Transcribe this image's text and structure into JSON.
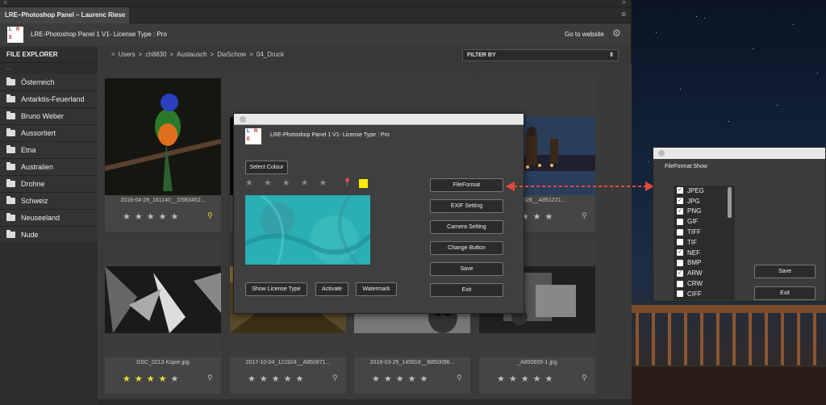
{
  "window": {
    "title": "LRE–Photoshop Panel – Laurenc Riese"
  },
  "header": {
    "app_name": "LRE-Photoshop Panel 1 V1- License Type : Pro",
    "go_to_website": "Go to website",
    "logo_letters": [
      "L",
      "R",
      "E"
    ]
  },
  "explorer": {
    "title": "FILE EXPLORER",
    "parent": "..",
    "folders": [
      "Österreich",
      "Antarktis-Feuerland",
      "Bruno Weber",
      "Aussortiert",
      "Etna",
      "Australien",
      "Drohne",
      "Schweiz",
      "Neuseeland",
      "Nude"
    ]
  },
  "breadcrumb": [
    ">",
    "Users",
    ">",
    "ch8830",
    ">",
    "Austausch",
    ">",
    "DiaSchow",
    ">",
    "04_Druck"
  ],
  "filter": {
    "label": "FILTER BY"
  },
  "thumbnails": [
    {
      "caption": "2018-04-28_161140__D5B3452...",
      "rating": 0,
      "pin": "yellow"
    },
    {
      "caption": "",
      "rating": 0,
      "pin": ""
    },
    {
      "caption": "",
      "rating": 0,
      "pin": ""
    },
    {
      "caption": "...063628__A851221...",
      "rating": 0,
      "pin": "gray"
    },
    {
      "caption": "DSC_0213 Kopie.jpg",
      "rating": 4,
      "pin": "gray"
    },
    {
      "caption": "2017-10-04_121924__A850871...",
      "rating": 0,
      "pin": "gray"
    },
    {
      "caption": "2018-03-25_145918__B850096...",
      "rating": 0,
      "pin": "gray"
    },
    {
      "caption": "_A850655-1.jpg",
      "rating": 0,
      "pin": "gray"
    }
  ],
  "dialog": {
    "title": "LRE-Photoshop Panel 1 V1- License Type : Pro",
    "select_colour": "Select Colour",
    "buttons": [
      "FileFormat",
      "EXIF Setting",
      "Camera Setting",
      "Change Button",
      "Save",
      "Exit"
    ],
    "bottom_buttons": [
      "Show License Type",
      "Activate",
      "Watermark"
    ],
    "rating": 0,
    "accent_color": "#ffee00"
  },
  "fileformat": {
    "title": "FileFormat Show",
    "formats": [
      {
        "name": "JPEG",
        "checked": true
      },
      {
        "name": "JPG",
        "checked": true
      },
      {
        "name": "PNG",
        "checked": true
      },
      {
        "name": "GIF",
        "checked": false
      },
      {
        "name": "TIFF",
        "checked": false
      },
      {
        "name": "TIF",
        "checked": false
      },
      {
        "name": "NEF",
        "checked": true
      },
      {
        "name": "BMP",
        "checked": false
      },
      {
        "name": "ARW",
        "checked": true
      },
      {
        "name": "CRW",
        "checked": false
      },
      {
        "name": "CIFF",
        "checked": false
      }
    ],
    "save": "Save",
    "exit": "Exit"
  },
  "colors": {
    "star_active": "#f0e030",
    "arrow": "#e04a3a"
  }
}
